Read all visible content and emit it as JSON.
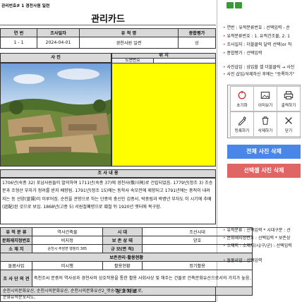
{
  "topbar": {
    "caption": "관리번호# 1 경천사원 일련",
    "title": "관리카드"
  },
  "header_cols": [
    "연 번",
    "조사일자",
    "유 적 명",
    "종합평가"
  ],
  "record": {
    "no": "1 - 1",
    "date": "2024-04-01",
    "site_name": "경천사원 일련",
    "grade": "상"
  },
  "photo_label": "사 진",
  "location_label": "위 치",
  "map_label": "도면번호",
  "survey_label": "조 사 내 용",
  "survey_text": "1706년(숙종 32) 포남사원들이 발의하여 1711년(숙종 37)에 경천사(敬川祠)로 건립되었음. 1779년(정조 3) 조승문과 조형산 부자가 정려를 받지 배향됨. 1791년(정조 15)에는 동학사 숙모전에 제향되고 1791년에는 중직이 내려지는 등 선양(宣揚)이 이루어짐. 순천을 관향으로 하는 단종의 충신인 김종서, 박중림과 박병년 부자도 이 시기에 추배(追配)된 것으로 보임. 1868년(고종 5) 서원철폐령으로 훼철 뒤 1920년 엣터에 복구함.",
  "details": [
    {
      "l1": "유 적 분 류",
      "v1": "역사건축물",
      "l2": "시 대",
      "v2": "조선시대"
    },
    {
      "l1": "문화재지정번호",
      "v1": "비지정",
      "l2": "보 존 상 태",
      "v2": "양호"
    },
    {
      "l1": "소 재 지",
      "v1": "순천시 주암면 행정리 385",
      "l2": "규 모(면 적)",
      "v2": ""
    }
  ],
  "preservation_label": "보존관리·활용현황",
  "pres_headers": [
    "돌봄사업",
    "미시행",
    "활용현황",
    "정기활용"
  ],
  "unit_label": "조 사 단 의 견",
  "unit_text": "죽천조씨 문중의 역사성과 경천사와 상호작용을 통한 활용 사회사상 및 해주는 건물로 건축문화유산으로서의 가치가 높음.",
  "ref_label": "참 고 자 료",
  "ref_text": "순천시의문화유산, 순천시의문화유산, 순천시의문화유산2_엣송주군출장음으로,\n문화유적분포지도,",
  "notes": [
    "연번 : 유적분류번호 : 선택입력 - 순",
    "유적분류번호 : 1. 유적건조물, 2. 1",
    "조사일자 : 더블클릭 달력 선택(or 직",
    "종합평가 : 선택입력",
    "사진삽입 : 삼입할 셀 더블클릭 → 사진",
    "사진 삽입/삭제하신 후에는 \"등록하기\""
  ],
  "buttons": [
    {
      "label": "초기화",
      "icon": "reset-icon"
    },
    {
      "label": "이미보기",
      "icon": "image-view-icon"
    },
    {
      "label": "출력하기",
      "icon": "print-icon"
    },
    {
      "label": "등록하기",
      "icon": "register-icon"
    },
    {
      "label": "삭제하기",
      "icon": "delete-icon"
    },
    {
      "label": "닫기",
      "icon": "close-icon"
    }
  ],
  "delete_all_label": "전체 사진 삭제",
  "delete_selected_label": "선택셀 사진 삭제",
  "notes2": [
    "유적분류 : 선택입력 * 시대구분 : 선",
    "문화재지정번호 : 선택입력 * 보존상",
    "소재지 : 소재지(시/구/군) : 선택입력"
  ],
  "note3": "돌봄사업 : 선택입력",
  "colors": {
    "accent_blue": "#4a86e8",
    "accent_red": "#e06666",
    "map_fill": "#ffff00",
    "note_red": "#d04040"
  }
}
